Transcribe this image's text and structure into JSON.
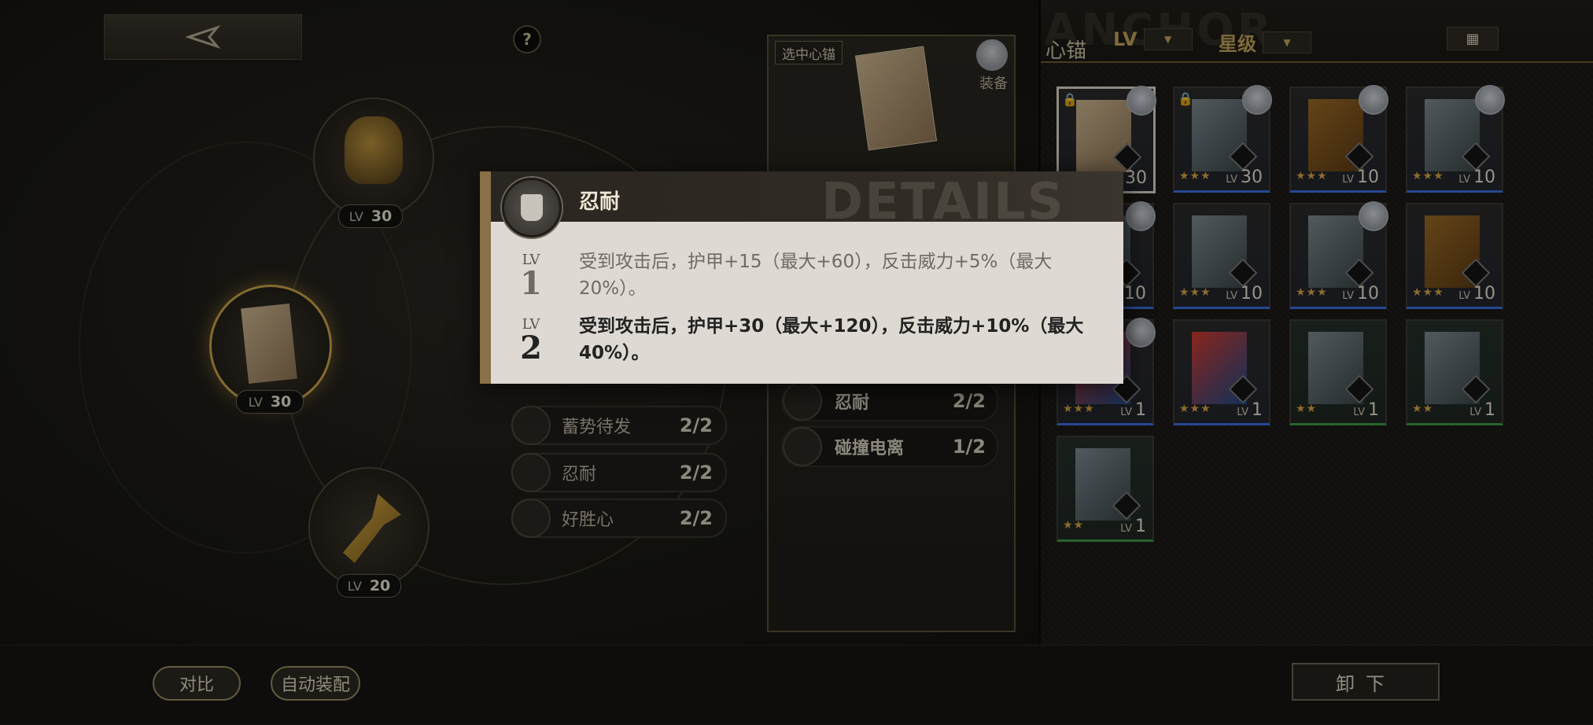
{
  "left": {
    "slots": [
      {
        "lv_label": "LV",
        "lv": "30"
      },
      {
        "lv_label": "LV",
        "lv": "30"
      },
      {
        "lv_label": "LV",
        "lv": "20"
      }
    ],
    "traits": [
      {
        "name": "蓄势待发",
        "count": "2/2"
      },
      {
        "name": "忍耐",
        "count": "2/2"
      },
      {
        "name": "好胜心",
        "count": "2/2"
      }
    ],
    "help_label": "?"
  },
  "mid_panel": {
    "selected_tag": "选中心锚",
    "equip_label": "装备",
    "traits": [
      {
        "name": "忍耐",
        "count": "2/2"
      },
      {
        "name": "碰撞电离",
        "count": "1/2"
      }
    ]
  },
  "right": {
    "title": "心锚",
    "bg_word": "ANCHOR",
    "filter_lv_label": "LV",
    "filter_star_label": "星级",
    "cards": [
      {
        "lv_label": "LV",
        "lv": "30",
        "stars": "★★★",
        "lock": true,
        "owner": true,
        "art": "paper",
        "rarity": "blue",
        "selected": true
      },
      {
        "lv_label": "LV",
        "lv": "30",
        "stars": "★★★",
        "lock": true,
        "owner": true,
        "art": "photo",
        "rarity": "blue"
      },
      {
        "lv_label": "LV",
        "lv": "10",
        "stars": "★★★",
        "owner": true,
        "art": "book",
        "rarity": "blue"
      },
      {
        "lv_label": "LV",
        "lv": "10",
        "stars": "★★★",
        "owner": true,
        "art": "photo",
        "rarity": "blue"
      },
      {
        "lv_label": "LV",
        "lv": "10",
        "stars": "★★★",
        "owner": true,
        "art": "photo",
        "rarity": "blue"
      },
      {
        "lv_label": "LV",
        "lv": "10",
        "stars": "★★★",
        "art": "photo",
        "rarity": "blue"
      },
      {
        "lv_label": "LV",
        "lv": "10",
        "stars": "★★★",
        "owner": true,
        "art": "photo",
        "rarity": "blue"
      },
      {
        "lv_label": "LV",
        "lv": "10",
        "stars": "★★★",
        "art": "book",
        "rarity": "blue"
      },
      {
        "lv_label": "LV",
        "lv": "1",
        "stars": "★★★",
        "owner": true,
        "art": "mag",
        "rarity": "blue"
      },
      {
        "lv_label": "LV",
        "lv": "1",
        "stars": "★★★",
        "art": "mag",
        "rarity": "blue"
      },
      {
        "lv_label": "LV",
        "lv": "1",
        "stars": "★★",
        "art": "photo",
        "rarity": "green"
      },
      {
        "lv_label": "LV",
        "lv": "1",
        "stars": "★★",
        "art": "photo",
        "rarity": "green"
      },
      {
        "lv_label": "LV",
        "lv": "1",
        "stars": "★★",
        "art": "photo",
        "rarity": "green"
      }
    ]
  },
  "bottom": {
    "compare_label": "对比",
    "auto_equip_label": "自动装配",
    "unload_label": "卸下"
  },
  "popup": {
    "title": "忍耐",
    "watermark": "DETAILS",
    "levels": [
      {
        "lv_label": "LV",
        "lv": "1",
        "desc": "受到攻击后，护甲+15（最大+60），反击威力+5%（最大20%）。",
        "color": "#6f6a63"
      },
      {
        "lv_label": "LV",
        "lv": "2",
        "desc": "受到攻击后，护甲+30（最大+120），反击威力+10%（最大40%）。",
        "color": "#222222"
      }
    ]
  },
  "colors": {
    "accent_gold": "#c9a54a",
    "rarity_blue": "#3b6ee0",
    "rarity_green": "#3d9a47"
  }
}
